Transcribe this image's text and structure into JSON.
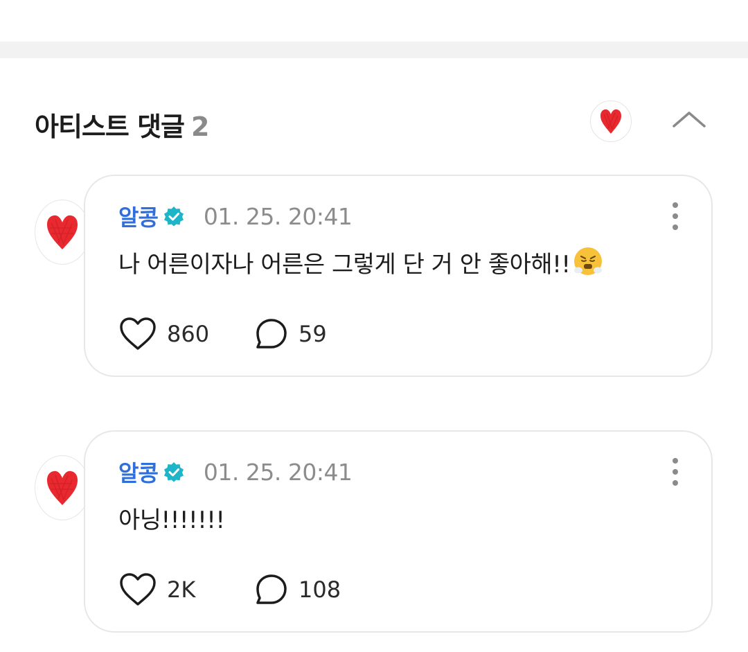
{
  "section": {
    "title": "아티스트 댓글",
    "count": "2"
  },
  "comments": [
    {
      "author": "알콩",
      "timestamp": "01. 25. 20:41",
      "text": "나 어른이자나 어른은 그렇게 단 거 안 좋아해!!",
      "emoji": "triumph-face-emoji",
      "likes": "860",
      "replies": "59"
    },
    {
      "author": "알콩",
      "timestamp": "01. 25. 20:41",
      "text": "아닝!!!!!!!",
      "likes": "2K",
      "replies": "108"
    }
  ],
  "colors": {
    "author": "#2f6fdc",
    "verified": "#1fb5c9",
    "heart_avatar": "#e8292f"
  }
}
